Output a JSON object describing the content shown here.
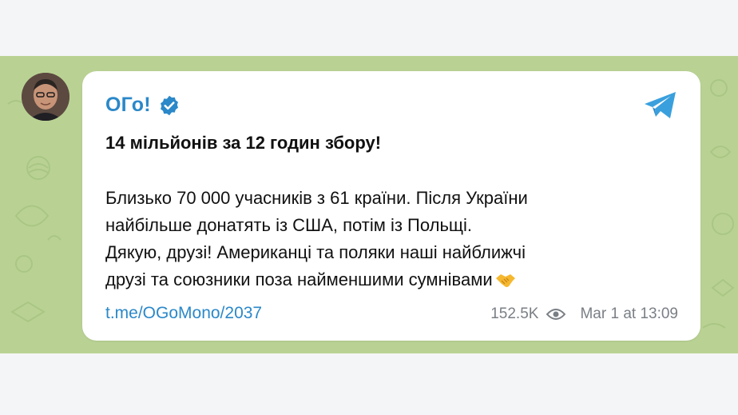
{
  "post": {
    "channel_name": "ОГо!",
    "headline": "14 мільйонів за 12 годин збору!",
    "body_lines": [
      "Близько 70 000 учасників з 61 країни. Після України",
      "найбільше донатять із США, потім із Польщі.",
      "Дякую, друзі! Американці та поляки наші найближчі",
      "друзі та союзники поза найменшими сумнівами"
    ],
    "link": "t.me/OGoMono/2037",
    "views": "152.5K",
    "date": "Mar 1 at 13:09"
  },
  "icons": {
    "verified": "verified-badge-icon",
    "telegram": "telegram-plane-icon",
    "views": "eye-icon",
    "emoji": "handshake-emoji"
  },
  "colors": {
    "accent": "#2b88c9",
    "background": "#b9d294",
    "card": "#ffffff",
    "meta": "#7a7f85"
  }
}
